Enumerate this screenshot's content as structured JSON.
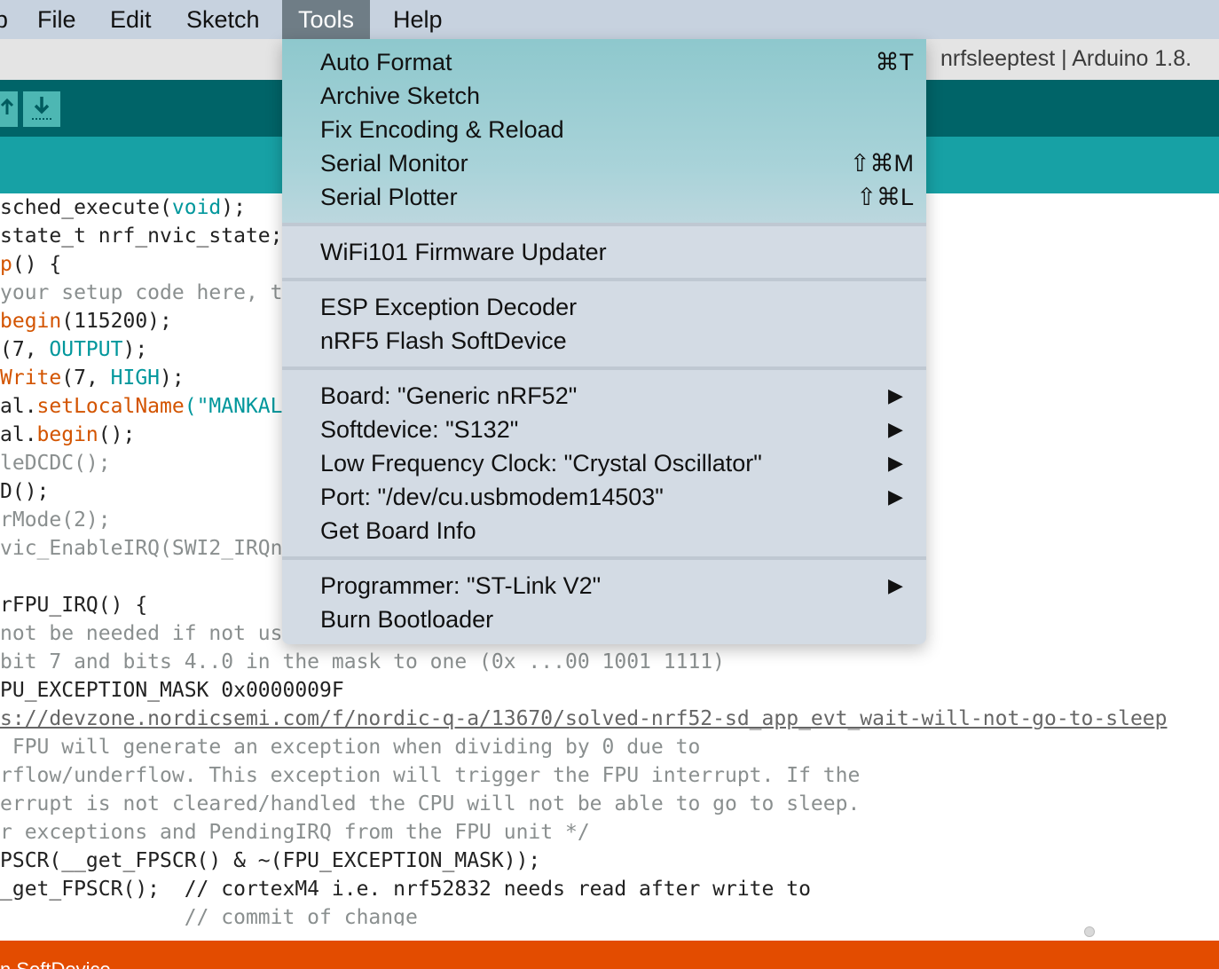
{
  "menubar": {
    "items": [
      "File",
      "Edit",
      "Sketch",
      "Tools",
      "Help"
    ],
    "active": "Tools"
  },
  "window": {
    "title": "nrfsleeptest | Arduino 1.8."
  },
  "toolbar": {
    "buttons": [
      "upload-icon",
      "save-icon"
    ]
  },
  "tools_menu": {
    "groups": [
      [
        {
          "label": "Auto Format",
          "shortcut": "⌘T"
        },
        {
          "label": "Archive Sketch",
          "shortcut": ""
        },
        {
          "label": "Fix Encoding & Reload",
          "shortcut": ""
        },
        {
          "label": "Serial Monitor",
          "shortcut": "⇧⌘M"
        },
        {
          "label": "Serial Plotter",
          "shortcut": "⇧⌘L"
        }
      ],
      [
        {
          "label": "WiFi101 Firmware Updater",
          "shortcut": ""
        }
      ],
      [
        {
          "label": "ESP Exception Decoder",
          "shortcut": ""
        },
        {
          "label": "nRF5 Flash SoftDevice",
          "shortcut": ""
        }
      ],
      [
        {
          "label": "Board: \"Generic nRF52\"",
          "submenu": true
        },
        {
          "label": "Softdevice: \"S132\"",
          "submenu": true
        },
        {
          "label": "Low Frequency Clock: \"Crystal Oscillator\"",
          "submenu": true
        },
        {
          "label": "Port: \"/dev/cu.usbmodem14503\"",
          "submenu": true
        },
        {
          "label": "Get Board Info",
          "submenu": false
        }
      ],
      [
        {
          "label": "Programmer: \"ST-Link V2\"",
          "submenu": true
        },
        {
          "label": "Burn Bootloader",
          "submenu": false
        }
      ]
    ]
  },
  "editor": {
    "lines": [
      [
        [
          "sched_execute(",
          ""
        ],
        [
          "void",
          "kw"
        ],
        [
          ");",
          ""
        ]
      ],
      [
        [
          "state_t nrf_nvic_state;",
          ""
        ]
      ],
      [
        [
          "p",
          "hl"
        ],
        [
          "() {",
          ""
        ]
      ],
      [
        [
          "your setup code here, t",
          "comment"
        ]
      ],
      [
        [
          "begin",
          "hl"
        ],
        [
          "(115200);",
          ""
        ]
      ],
      [
        [
          "(7, ",
          ""
        ],
        [
          "OUTPUT",
          "kw"
        ],
        [
          ");",
          ""
        ]
      ],
      [
        [
          "Write",
          "hl"
        ],
        [
          "(7, ",
          ""
        ],
        [
          "HIGH",
          "kw"
        ],
        [
          ");",
          ""
        ]
      ],
      [
        [
          "al.",
          ""
        ],
        [
          "setLocalName",
          "hl"
        ],
        [
          "(\"MANKAL",
          "kw"
        ]
      ],
      [
        [
          "al.",
          ""
        ],
        [
          "begin",
          "hl"
        ],
        [
          "();",
          ""
        ]
      ],
      [
        [
          "leDCDC();",
          "comment"
        ]
      ],
      [
        [
          "D();",
          ""
        ]
      ],
      [
        [
          "rMode(2);",
          "comment"
        ]
      ],
      [
        [
          "vic_EnableIRQ(SWI2_IRQn",
          "comment"
        ]
      ],
      [
        [
          "",
          ""
        ]
      ],
      [
        [
          "rFPU_IRQ() {",
          ""
        ]
      ],
      [
        [
          "not be needed if not us",
          "comment"
        ]
      ],
      [
        [
          "bit 7 and bits 4..0 in the mask to one (0x ...00 1001 1111)",
          "comment"
        ]
      ],
      [
        [
          "PU_EXCEPTION_MASK 0x0000009F",
          ""
        ]
      ],
      [
        [
          "s://devzone.nordicsemi.com/f/nordic-q-a/13670/solved-nrf52-sd_app_evt_wait-will-not-go-to-sleep",
          "link"
        ]
      ],
      [
        [
          " FPU will generate an exception when dividing by 0 due to",
          "comment"
        ]
      ],
      [
        [
          "rflow/underflow. This exception will trigger the FPU interrupt. If the",
          "comment"
        ]
      ],
      [
        [
          "errupt is not cleared/handled the CPU will not be able to go to sleep.",
          "comment"
        ]
      ],
      [
        [
          "r exceptions and PendingIRQ from the FPU unit */",
          "comment"
        ]
      ],
      [
        [
          "PSCR(__get_FPSCR() & ~(FPU_EXCEPTION_MASK));",
          ""
        ]
      ],
      [
        [
          "_get_FPSCR();  // cortexM4 i.e. nrf52832 needs read after write to",
          ""
        ]
      ],
      [
        [
          "               // commit of change",
          "comment"
        ]
      ]
    ]
  },
  "console": {
    "text": "n SoftDevice"
  },
  "colors": {
    "menubar": "#c7d2df",
    "toolbar": "#006468",
    "tabstrip": "#17a1a5",
    "console": "#e34c00",
    "menu_bg": "#d3dbe4",
    "menu_highlight": "#9fcfd4"
  }
}
